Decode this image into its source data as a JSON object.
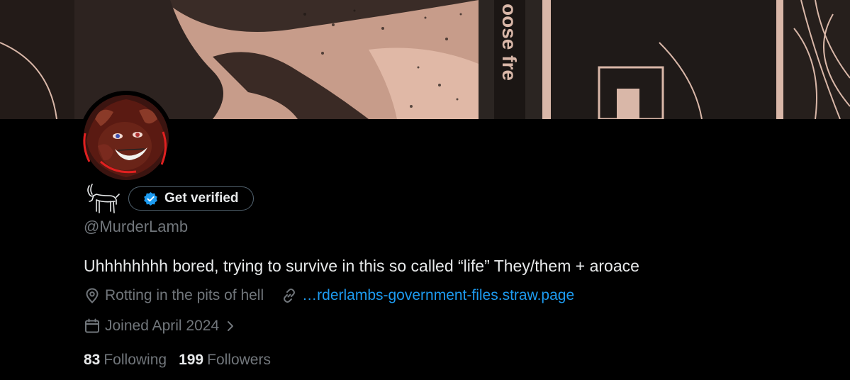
{
  "banner": {
    "vertical_text": "oose fre"
  },
  "profile": {
    "verify_button_label": "Get verified",
    "handle": "@MurderLamb",
    "bio": "Uhhhhhhhh bored, trying to survive in this so called “life” They/them + aroace",
    "location": "Rotting in the pits of hell",
    "website": "…rderlambs-government-files.straw.page",
    "joined": "Joined April 2024",
    "following_count": "83",
    "following_label": "Following",
    "followers_count": "199",
    "followers_label": "Followers"
  },
  "colors": {
    "background": "#000000",
    "primary_text": "#e7e9ea",
    "secondary_text": "#71767b",
    "link": "#1d9bf0",
    "verified_badge": "#1d9bf0",
    "button_border": "#536471"
  },
  "icons": {
    "display_name": "goat-emoji-icon",
    "verify_badge": "verified-badge-icon",
    "location": "location-pin-icon",
    "website": "link-icon",
    "joined": "calendar-icon",
    "joined_more": "chevron-right-icon"
  }
}
